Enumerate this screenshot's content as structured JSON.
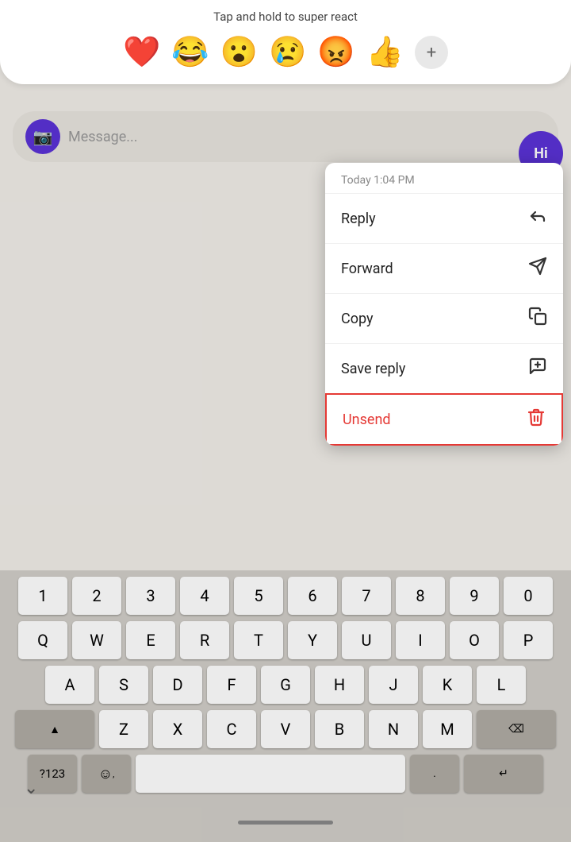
{
  "tap_hint": "Tap and hold to super react",
  "emojis": [
    "❤️",
    "😂",
    "😮",
    "😢",
    "😡",
    "👍"
  ],
  "plus_label": "+",
  "hi_label": "Hi",
  "message_placeholder": "Message...",
  "timestamp": "Today 1:04 PM",
  "menu_items": [
    {
      "label": "Reply",
      "icon": "reply"
    },
    {
      "label": "Forward",
      "icon": "forward"
    },
    {
      "label": "Copy",
      "icon": "copy"
    },
    {
      "label": "Save reply",
      "icon": "save-reply"
    },
    {
      "label": "Unsend",
      "icon": "trash",
      "type": "unsend"
    }
  ],
  "keyboard": {
    "row1": [
      "1",
      "2",
      "3",
      "4",
      "5",
      "6",
      "7",
      "8",
      "9",
      "0"
    ],
    "row2": [
      "Q",
      "W",
      "E",
      "R",
      "T",
      "Y",
      "U",
      "I",
      "O",
      "P"
    ],
    "row3": [
      "A",
      "S",
      "D",
      "F",
      "G",
      "H",
      "J",
      "K",
      "L"
    ],
    "row4": [
      "Z",
      "X",
      "C",
      "V",
      "B",
      "N",
      "M"
    ],
    "special": {
      "shift": "▲",
      "backspace": "⌫",
      "symbols": "?123",
      "emoji": "☺",
      "comma": ",",
      "space": "",
      "period": ".",
      "enter": "↵"
    }
  }
}
